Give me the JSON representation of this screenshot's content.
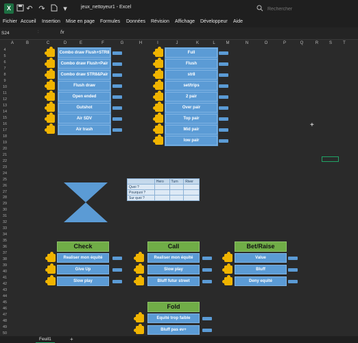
{
  "titlebar": {
    "logo": "X",
    "doc_title": "jeux_nettoyeur1 - Excel",
    "search_placeholder": "Rechercher",
    "icons": [
      "save-icon",
      "undo-icon",
      "redo-icon",
      "document-icon"
    ]
  },
  "menu": [
    "Fichier",
    "Accueil",
    "Insertion",
    "Mise en page",
    "Formules",
    "Données",
    "Révision",
    "Affichage",
    "Développeur",
    "Aide"
  ],
  "formula_bar": {
    "name_box": "S24",
    "fx": "fx",
    "separator": ":"
  },
  "columns": [
    "A",
    "B",
    "C",
    "D",
    "E",
    "F",
    "G",
    "H",
    "I",
    "J",
    "K",
    "L",
    "M",
    "N",
    "O",
    "P",
    "Q",
    "R",
    "S",
    "T"
  ],
  "rows": [
    "4",
    "5",
    "6",
    "7",
    "8",
    "9",
    "10",
    "11",
    "12",
    "13",
    "14",
    "15",
    "16",
    "17",
    "18",
    "19",
    "20",
    "21",
    "22",
    "23",
    "24",
    "25",
    "26",
    "27",
    "28",
    "29",
    "30",
    "31",
    "32",
    "33",
    "34",
    "35",
    "36",
    "37",
    "38",
    "39",
    "40",
    "41",
    "42",
    "43",
    "44",
    "45",
    "46",
    "47",
    "48",
    "49",
    "50"
  ],
  "left_panel": [
    "Combo draw Flush+STR8",
    "Combo draw Flush+Pair",
    "Combo draw STR8&Pair",
    "Flush draw",
    "Open ended",
    "Gutshot",
    "Air SDV",
    "Air trash"
  ],
  "right_panel": [
    "Full",
    "Flush",
    "str8",
    "set/trips",
    "2 pair",
    "Over pair",
    "Top pair",
    "Mid pair",
    "low pair"
  ],
  "mini_table": {
    "headers": [
      "",
      "Hero",
      "Turn",
      "River"
    ],
    "rows": [
      "Quoi ?",
      "Pourquoi ?",
      "Sur quoi ?"
    ]
  },
  "check": {
    "title": "Check",
    "items": [
      "Realiser mon équité",
      "Give Up",
      "Slow play"
    ]
  },
  "call": {
    "title": "Call",
    "items": [
      "Realiser mon équité",
      "Slow play",
      "Bluff futur street"
    ]
  },
  "bet": {
    "title": "Bet/Raise",
    "items": [
      "Value",
      "Bluff",
      "Deny equité"
    ]
  },
  "fold": {
    "title": "Fold",
    "items": [
      "Equité trop faible",
      "Bluff pas ev+"
    ]
  },
  "sheet_tabs": [
    "Feuil1"
  ],
  "add_sheet": "+",
  "colors": {
    "accent_blue": "#5b9bd5",
    "puzzle_yellow": "#f0b400",
    "green": "#70ad47",
    "background": "#2a2a2a"
  }
}
